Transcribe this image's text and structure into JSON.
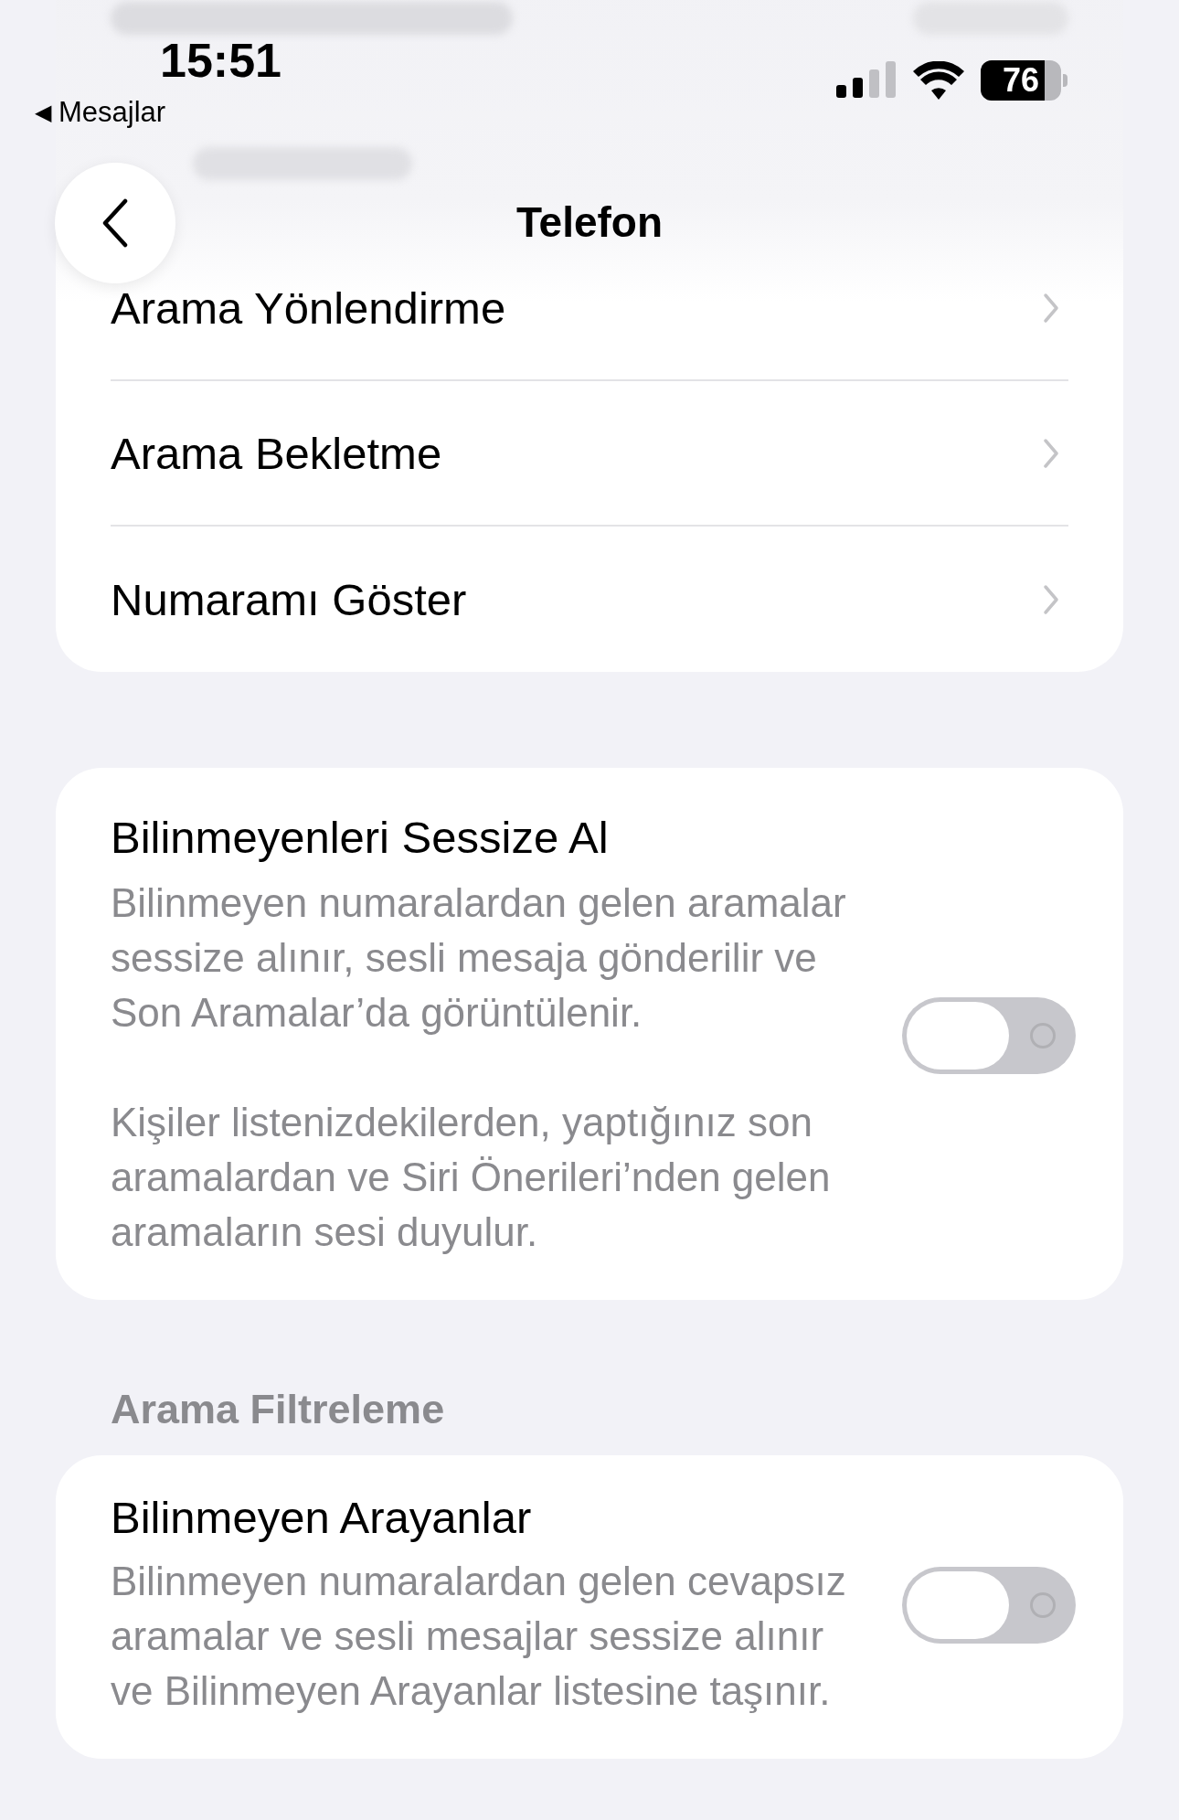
{
  "status_bar": {
    "time": "15:51",
    "back_arrow": "◀",
    "back_app": "Mesajlar",
    "battery": "76"
  },
  "nav": {
    "title": "Telefon"
  },
  "top_group": {
    "rows": [
      {
        "label": "Arama Yönlendirme"
      },
      {
        "label": "Arama Bekletme"
      },
      {
        "label": "Numaramı Göster"
      }
    ]
  },
  "silence_unknown": {
    "title": "Bilinmeyenleri Sessize Al",
    "description": "Bilinmeyen numaralardan gelen aramalar sessize alınır, sesli mesaja gönderilir ve Son Aramalar’da görüntülenir.",
    "note": "Kişiler listenizdekilerden, yaptığınız son aramalardan ve Siri Önerileri’nden gelen aramaların sesi duyulur.",
    "on": false
  },
  "call_filtering": {
    "header": "Arama Filtreleme",
    "title": "Bilinmeyen Arayanlar",
    "description": "Bilinmeyen numaralardan gelen cevapsız aramalar ve sesli mesajlar sessize alınır ve Bilinmeyen Arayanlar listesine taşınır.",
    "on": false
  }
}
